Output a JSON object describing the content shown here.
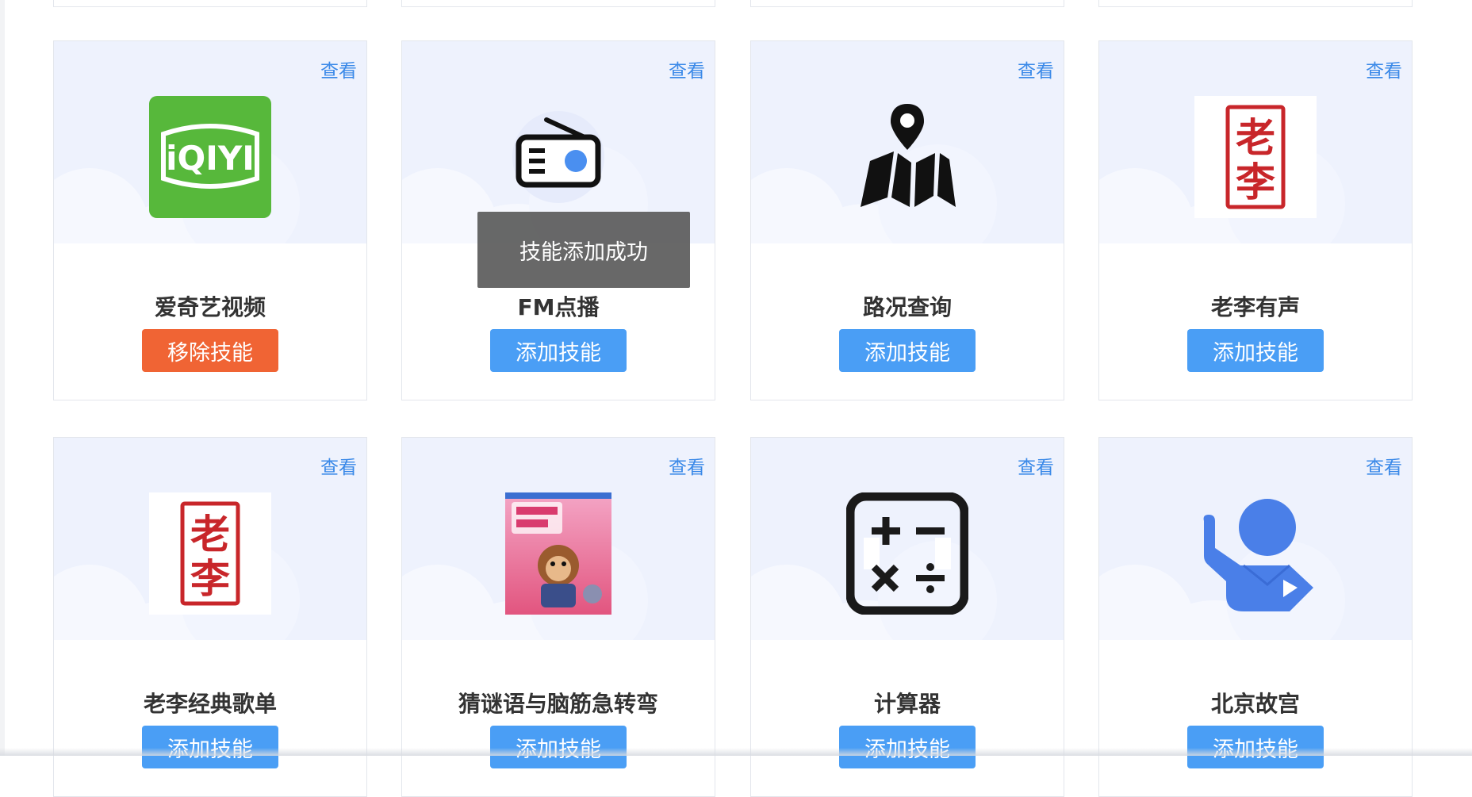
{
  "toast": {
    "message": "技能添加成功"
  },
  "view_label": "查看",
  "colors": {
    "accent": "#4a9ef5",
    "remove": "#f06434",
    "link": "#3a89e8",
    "card_top": "#eef2fd"
  },
  "skills": [
    {
      "name": "爱奇艺视频",
      "icon": "iqiyi-icon",
      "button": "移除技能",
      "state": "added"
    },
    {
      "name": "FM点播",
      "icon": "radio-icon",
      "button": "添加技能",
      "state": "not-added"
    },
    {
      "name": "路况查询",
      "icon": "map-pin-icon",
      "button": "添加技能",
      "state": "not-added"
    },
    {
      "name": "老李有声",
      "icon": "laoli-seal-icon",
      "button": "添加技能",
      "state": "not-added"
    },
    {
      "name": "老李经典歌单",
      "icon": "laoli-seal-icon",
      "button": "添加技能",
      "state": "not-added"
    },
    {
      "name": "猜谜语与脑筋急转弯",
      "icon": "riddle-book-cover-icon",
      "button": "添加技能",
      "state": "not-added"
    },
    {
      "name": "计算器",
      "icon": "calculator-icon",
      "button": "添加技能",
      "state": "not-added"
    },
    {
      "name": "北京故宫",
      "icon": "tour-guide-icon",
      "button": "添加技能",
      "state": "not-added"
    }
  ]
}
